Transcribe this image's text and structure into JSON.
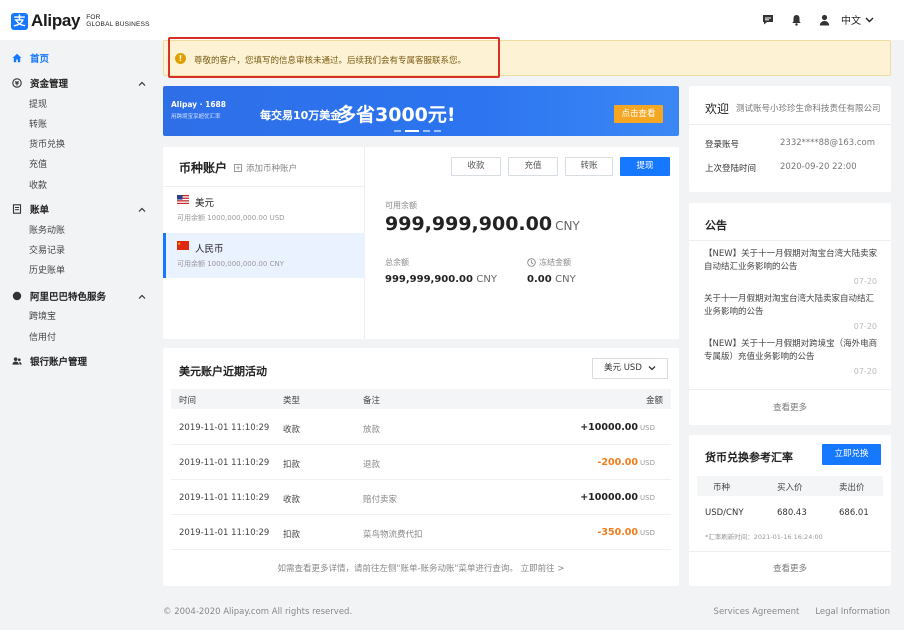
{
  "header": {
    "logo_mark": "支",
    "logo_text": "Alipay",
    "logo_sub_1": "FOR",
    "logo_sub_2": "GLOBAL BUSINESS",
    "language": "中文"
  },
  "sidebar": {
    "home": "首页",
    "groups": [
      {
        "label": "资金管理",
        "items": [
          "提现",
          "转账",
          "货币兑换",
          "充值",
          "收款"
        ]
      },
      {
        "label": "账单",
        "items": [
          "账务动账",
          "交易记录",
          "历史账单"
        ]
      },
      {
        "label": "阿里巴巴特色服务",
        "items": [
          "跨境宝",
          "信用付"
        ]
      },
      {
        "label": "银行账户管理",
        "items": []
      }
    ]
  },
  "alert": {
    "text": "尊敬的客户，您填写的信息审核未通过。后续我们会有专属客服联系您。"
  },
  "banner": {
    "brand": "Alipay · 1688",
    "brand_sub": "用跨境宝享超优汇率",
    "mid": "每交易10万美金",
    "big": "多省3000元!",
    "button": "点击查看"
  },
  "account": {
    "title": "币种账户",
    "add_label": "添加币种账户",
    "currencies": [
      {
        "name": "美元",
        "balance": "可用余额 1000,000,000.00 USD"
      },
      {
        "name": "人民币",
        "balance": "可用余额 1000,000,000.00 CNY"
      }
    ],
    "buttons": [
      "收款",
      "充值",
      "转账",
      "提现"
    ],
    "available_label": "可用余额",
    "available_value": "999,999,900.00",
    "available_currency": "CNY",
    "total_label": "总余额",
    "total_value": "999,999,900.00",
    "total_currency": "CNY",
    "frozen_label": "冻结金额",
    "frozen_value": "0.00",
    "frozen_currency": "CNY"
  },
  "activity": {
    "title": "美元账户近期活动",
    "select": "美元 USD",
    "columns": [
      "时间",
      "类型",
      "备注",
      "金额"
    ],
    "rows": [
      {
        "time": "2019-11-01 11:10:29",
        "type": "收款",
        "note": "放款",
        "amount": "+10000.00",
        "unit": "USD"
      },
      {
        "time": "2019-11-01 11:10:29",
        "type": "扣款",
        "note": "退款",
        "amount": "-200.00",
        "unit": "USD"
      },
      {
        "time": "2019-11-01 11:10:29",
        "type": "收款",
        "note": "赔付卖家",
        "amount": "+10000.00",
        "unit": "USD"
      },
      {
        "time": "2019-11-01 11:10:29",
        "type": "扣款",
        "note": "菜鸟物流费代扣",
        "amount": "-350.00",
        "unit": "USD"
      }
    ],
    "footer": "如需查看更多详情，请前往左侧\"账单-账务动账\"菜单进行查询。 立即前往 >"
  },
  "welcome": {
    "title": "欢迎",
    "company": "测试账号小珍珍生命科技责任有限公司",
    "login_label": "登录账号",
    "login_value": "2332****88@163.com",
    "last_login_label": "上次登陆时间",
    "last_login_value": "2020-09-20 22:00"
  },
  "notices": {
    "title": "公告",
    "items": [
      {
        "text": "【NEW】关于十一月假期对淘宝台湾大陆卖家自动结汇业务影响的公告",
        "date": "07-20"
      },
      {
        "text": "关于十一月假期对淘宝台湾大陆卖家自动结汇业务影响的公告",
        "date": "07-20"
      },
      {
        "text": "【NEW】关于十一月假期对跨境宝（海外电商专属版）充值业务影响的公告",
        "date": "07-20"
      }
    ],
    "more": "查看更多"
  },
  "rates": {
    "title": "货币兑换参考汇率",
    "button": "立即兑换",
    "columns": [
      "币种",
      "买入价",
      "卖出价"
    ],
    "pair": "USD/CNY",
    "buy": "680.43",
    "sell": "686.01",
    "note": "*汇率刷新时间：2021-01-16 16:24:00",
    "more": "查看更多"
  },
  "footer": {
    "copyright": "© 2004-2020 Alipay.com All rights reserved.",
    "services": "Services Agreement",
    "legal": "Legal Information"
  },
  "colors": {
    "primary": "#1677ff",
    "alert_bg": "#fdf3d4",
    "highlight_border": "#d93025",
    "negative_amount": "#f07c1c",
    "banner_button": "#f5a623"
  }
}
